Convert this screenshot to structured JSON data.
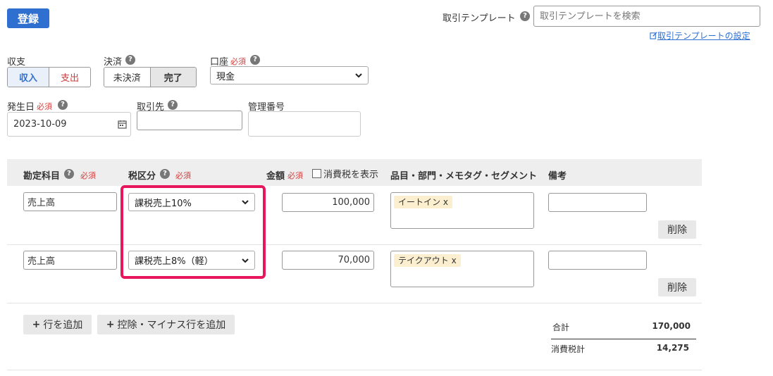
{
  "header": {
    "register_label": "登録",
    "template_label": "取引テンプレート",
    "template_search_placeholder": "取引テンプレートを検索",
    "template_settings_link": "取引テンプレートの設定"
  },
  "form": {
    "income_expense_label": "収支",
    "income_label": "収入",
    "expense_label": "支出",
    "settlement_label": "決済",
    "unsettled_label": "未決済",
    "settled_label": "完了",
    "account_label": "口座",
    "account_value": "現金",
    "required_label": "必須",
    "date_label": "発生日",
    "date_value": "2023-10-09",
    "partner_label": "取引先",
    "partner_value": "",
    "ref_number_label": "管理番号",
    "ref_number_value": ""
  },
  "table": {
    "headers": {
      "account_item": "勘定科目",
      "tax_category": "税区分",
      "amount": "金額",
      "show_tax": "消費税を表示",
      "item_dept": "品目・部門・メモタグ・セグメント",
      "remarks": "備考"
    },
    "rows": [
      {
        "account_item": "売上高",
        "tax_category": "課税売上10%",
        "amount": "100,000",
        "tag": "イートイン",
        "remarks": "",
        "delete_label": "削除"
      },
      {
        "account_item": "売上高",
        "tax_category": "課税売上8%（軽）",
        "amount": "70,000",
        "tag": "テイクアウト",
        "remarks": "",
        "delete_label": "削除"
      }
    ],
    "tag_remove": "x"
  },
  "actions": {
    "add_row": "行を追加",
    "add_deduction_row": "控除・マイナス行を追加"
  },
  "totals": {
    "total_label": "合計",
    "total_value": "170,000",
    "tax_label": "消費税計",
    "tax_value": "14,275"
  },
  "icons": {
    "help": "?",
    "plus": "+"
  },
  "colors": {
    "primary": "#2e6fd0",
    "required": "#d33c3c",
    "highlight": "#e8175d",
    "tag_bg": "#fbefcf"
  }
}
